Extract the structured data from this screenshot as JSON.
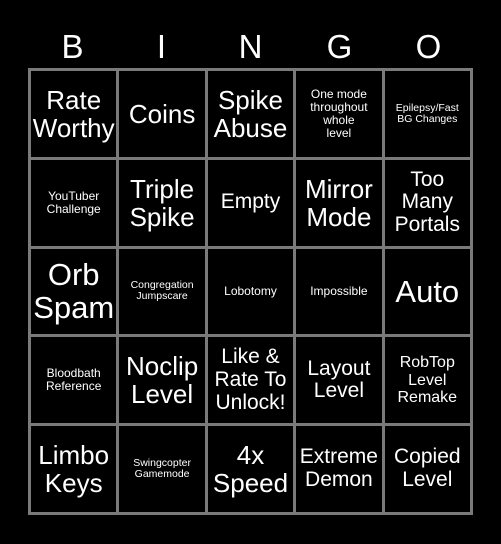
{
  "card": {
    "title": "BINGO",
    "background_color": "#000000",
    "text_color": "#ffffff",
    "border_color": "#7a7a7a",
    "headers": [
      "B",
      "I",
      "N",
      "G",
      "O"
    ],
    "rows": [
      [
        {
          "text": "Rate\nWorthy",
          "size": "lg"
        },
        {
          "text": "Coins",
          "size": "lg"
        },
        {
          "text": "Spike\nAbuse",
          "size": "lg"
        },
        {
          "text": "One mode\nthroughout\nwhole\nlevel",
          "size": "xs"
        },
        {
          "text": "Epilepsy/Fast\nBG Changes",
          "size": "xxs"
        }
      ],
      [
        {
          "text": "YouTuber\nChallenge",
          "size": "xs"
        },
        {
          "text": "Triple\nSpike",
          "size": "lg"
        },
        {
          "text": "Empty",
          "size": "md"
        },
        {
          "text": "Mirror\nMode",
          "size": "lg"
        },
        {
          "text": "Too\nMany\nPortals",
          "size": "md"
        }
      ],
      [
        {
          "text": "Orb\nSpam",
          "size": "xl"
        },
        {
          "text": "Congregation\nJumpscare",
          "size": "xxs"
        },
        {
          "text": "Lobotomy",
          "size": "xs"
        },
        {
          "text": "Impossible",
          "size": "xs"
        },
        {
          "text": "Auto",
          "size": "xl"
        }
      ],
      [
        {
          "text": "Bloodbath\nReference",
          "size": "xs"
        },
        {
          "text": "Noclip\nLevel",
          "size": "lg"
        },
        {
          "text": "Like &\nRate To\nUnlock!",
          "size": "md"
        },
        {
          "text": "Layout\nLevel",
          "size": "md"
        },
        {
          "text": "RobTop\nLevel\nRemake",
          "size": "sm"
        }
      ],
      [
        {
          "text": "Limbo\nKeys",
          "size": "lg"
        },
        {
          "text": "Swingcopter\nGamemode",
          "size": "xxs"
        },
        {
          "text": "4x\nSpeed",
          "size": "lg"
        },
        {
          "text": "Extreme\nDemon",
          "size": "md"
        },
        {
          "text": "Copied\nLevel",
          "size": "md"
        }
      ]
    ]
  }
}
